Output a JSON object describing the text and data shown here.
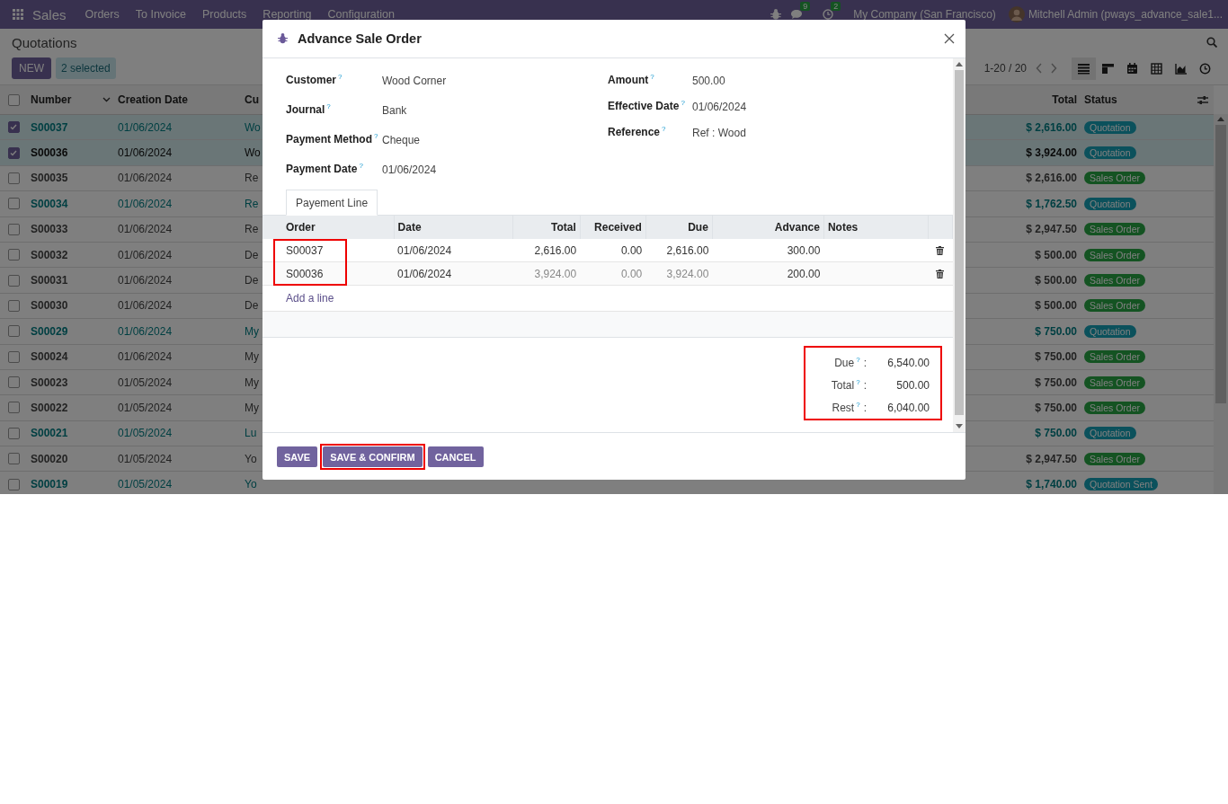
{
  "navbar": {
    "app": "Sales",
    "menu": [
      "Orders",
      "To Invoice",
      "Products",
      "Reporting",
      "Configuration"
    ],
    "messages_count": "9",
    "activities_count": "2",
    "company": "My Company (San Francisco)",
    "user": "Mitchell Admin (pways_advance_sale1..."
  },
  "control_panel": {
    "title": "Quotations",
    "new_button": "NEW",
    "selection": "2 selected",
    "pager": "1-20 / 20",
    "views": [
      {
        "kind": "list",
        "selected": true
      },
      {
        "kind": "kanban",
        "selected": false
      },
      {
        "kind": "calendar",
        "selected": false
      },
      {
        "kind": "pivot",
        "selected": false
      },
      {
        "kind": "graph",
        "selected": false
      },
      {
        "kind": "activity",
        "selected": false
      }
    ]
  },
  "list": {
    "all_selected": false,
    "columns": {
      "number": "Number",
      "date": "Creation Date",
      "customer": "Cu",
      "total": "Total",
      "status": "Status"
    },
    "rows": [
      {
        "selected": true,
        "focused": false,
        "number": "S00037",
        "date": "01/06/2024",
        "customer": "Wo",
        "total": "$ 2,616.00",
        "status": "Quotation",
        "kind": "quotation"
      },
      {
        "selected": true,
        "focused": true,
        "number": "S00036",
        "date": "01/06/2024",
        "customer": "Wo",
        "total": "$ 3,924.00",
        "status": "Quotation",
        "kind": "quotation"
      },
      {
        "selected": false,
        "focused": false,
        "number": "S00035",
        "date": "01/06/2024",
        "customer": "Re",
        "total": "$ 2,616.00",
        "status": "Sales Order",
        "kind": "sale"
      },
      {
        "selected": false,
        "focused": false,
        "number": "S00034",
        "date": "01/06/2024",
        "customer": "Re",
        "total": "$ 1,762.50",
        "status": "Quotation",
        "kind": "quotation"
      },
      {
        "selected": false,
        "focused": false,
        "number": "S00033",
        "date": "01/06/2024",
        "customer": "Re",
        "total": "$ 2,947.50",
        "status": "Sales Order",
        "kind": "sale"
      },
      {
        "selected": false,
        "focused": false,
        "number": "S00032",
        "date": "01/06/2024",
        "customer": "De",
        "total": "$ 500.00",
        "status": "Sales Order",
        "kind": "sale"
      },
      {
        "selected": false,
        "focused": false,
        "number": "S00031",
        "date": "01/06/2024",
        "customer": "De",
        "total": "$ 500.00",
        "status": "Sales Order",
        "kind": "sale"
      },
      {
        "selected": false,
        "focused": false,
        "number": "S00030",
        "date": "01/06/2024",
        "customer": "De",
        "total": "$ 500.00",
        "status": "Sales Order",
        "kind": "sale"
      },
      {
        "selected": false,
        "focused": false,
        "number": "S00029",
        "date": "01/06/2024",
        "customer": "My",
        "total": "$ 750.00",
        "status": "Quotation",
        "kind": "quotation"
      },
      {
        "selected": false,
        "focused": false,
        "number": "S00024",
        "date": "01/06/2024",
        "customer": "My",
        "total": "$ 750.00",
        "status": "Sales Order",
        "kind": "sale"
      },
      {
        "selected": false,
        "focused": false,
        "number": "S00023",
        "date": "01/05/2024",
        "customer": "My",
        "total": "$ 750.00",
        "status": "Sales Order",
        "kind": "sale"
      },
      {
        "selected": false,
        "focused": false,
        "number": "S00022",
        "date": "01/05/2024",
        "customer": "My",
        "total": "$ 750.00",
        "status": "Sales Order",
        "kind": "sale"
      },
      {
        "selected": false,
        "focused": false,
        "number": "S00021",
        "date": "01/05/2024",
        "customer": "Lu",
        "total": "$ 750.00",
        "status": "Quotation",
        "kind": "quotation"
      },
      {
        "selected": false,
        "focused": false,
        "number": "S00020",
        "date": "01/05/2024",
        "customer": "Yo",
        "total": "$ 2,947.50",
        "status": "Sales Order",
        "kind": "sale"
      },
      {
        "selected": false,
        "focused": false,
        "number": "S00019",
        "date": "01/05/2024",
        "customer": "Yo",
        "total": "$ 1,740.00",
        "status": "Quotation Sent",
        "kind": "sent"
      }
    ]
  },
  "dialog": {
    "title": "Advance Sale Order",
    "fields_left": [
      {
        "label": "Customer",
        "help": "?",
        "value": "Wood Corner"
      },
      {
        "label": "Journal",
        "help": "?",
        "value": "Bank"
      },
      {
        "label": "Payment Method",
        "help": "?",
        "value": "Cheque"
      },
      {
        "label": "Payment Date",
        "help": "?",
        "value": "01/06/2024"
      }
    ],
    "fields_right": [
      {
        "label": "Amount",
        "help": "?",
        "value": "500.00"
      },
      {
        "label": "Effective Date",
        "help": "?",
        "value": "01/06/2024"
      },
      {
        "label": "Reference",
        "help": "?",
        "value": "Ref : Wood"
      }
    ],
    "tabs": [
      {
        "label": "Payement Line",
        "selected": true
      }
    ],
    "lines": {
      "columns": [
        "Order",
        "Date",
        "Total",
        "Received",
        "Due",
        "Advance",
        "Notes"
      ],
      "order_column_highlighted": true,
      "rows": [
        {
          "order": "S00037",
          "date": "01/06/2024",
          "total": "2,616.00",
          "received": "0.00",
          "due": "2,616.00",
          "advance": "300.00",
          "muted": false
        },
        {
          "order": "S00036",
          "date": "01/06/2024",
          "total": "3,924.00",
          "received": "0.00",
          "due": "3,924.00",
          "advance": "200.00",
          "muted": true
        }
      ],
      "add_line": "Add a line"
    },
    "totals": {
      "highlighted": true,
      "items": [
        {
          "label": "Due",
          "help": "?",
          "colon": ":",
          "value": "6,540.00"
        },
        {
          "label": "Total",
          "help": "?",
          "colon": ":",
          "value": "500.00"
        },
        {
          "label": "Rest",
          "help": "?",
          "colon": ":",
          "value": "6,040.00"
        }
      ]
    },
    "buttons": [
      {
        "label": "SAVE",
        "highlighted": false
      },
      {
        "label": "SAVE & CONFIRM",
        "highlighted": true
      },
      {
        "label": "CANCEL",
        "highlighted": false
      }
    ]
  }
}
